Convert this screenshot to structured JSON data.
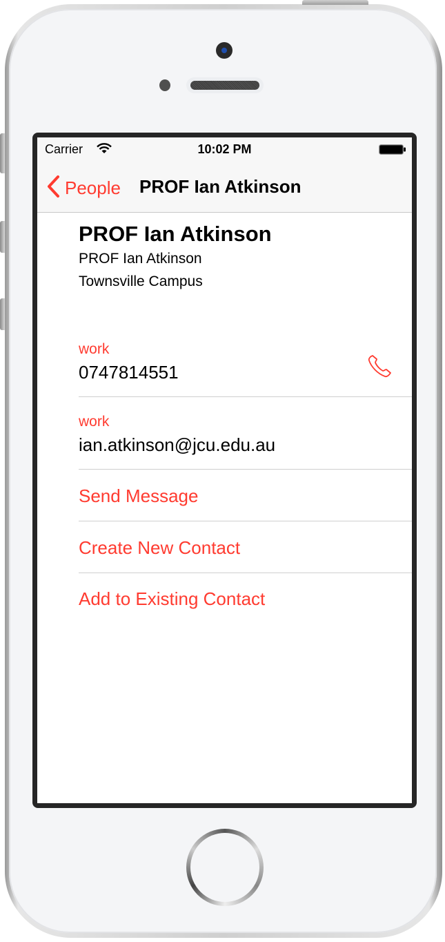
{
  "status_bar": {
    "carrier": "Carrier",
    "time": "10:02 PM",
    "wifi_icon": "wifi-icon",
    "battery_icon": "battery-full-icon"
  },
  "nav": {
    "back_label": "People",
    "back_icon": "chevron-left-icon",
    "title": "PROF Ian Atkinson"
  },
  "contact": {
    "name": "PROF Ian Atkinson",
    "subtitle_line1": "PROF Ian Atkinson",
    "subtitle_line2": "Townsville Campus",
    "fields": [
      {
        "label": "work",
        "value": "0747814551",
        "icon": "phone-icon"
      },
      {
        "label": "work",
        "value": "ian.atkinson@jcu.edu.au"
      }
    ],
    "actions": [
      {
        "label": "Send Message"
      },
      {
        "label": "Create New Contact"
      },
      {
        "label": "Add to Existing Contact"
      }
    ]
  },
  "colors": {
    "accent": "#ff3b30",
    "bar_background": "#f7f7f7",
    "separator": "#cfcfcf"
  }
}
